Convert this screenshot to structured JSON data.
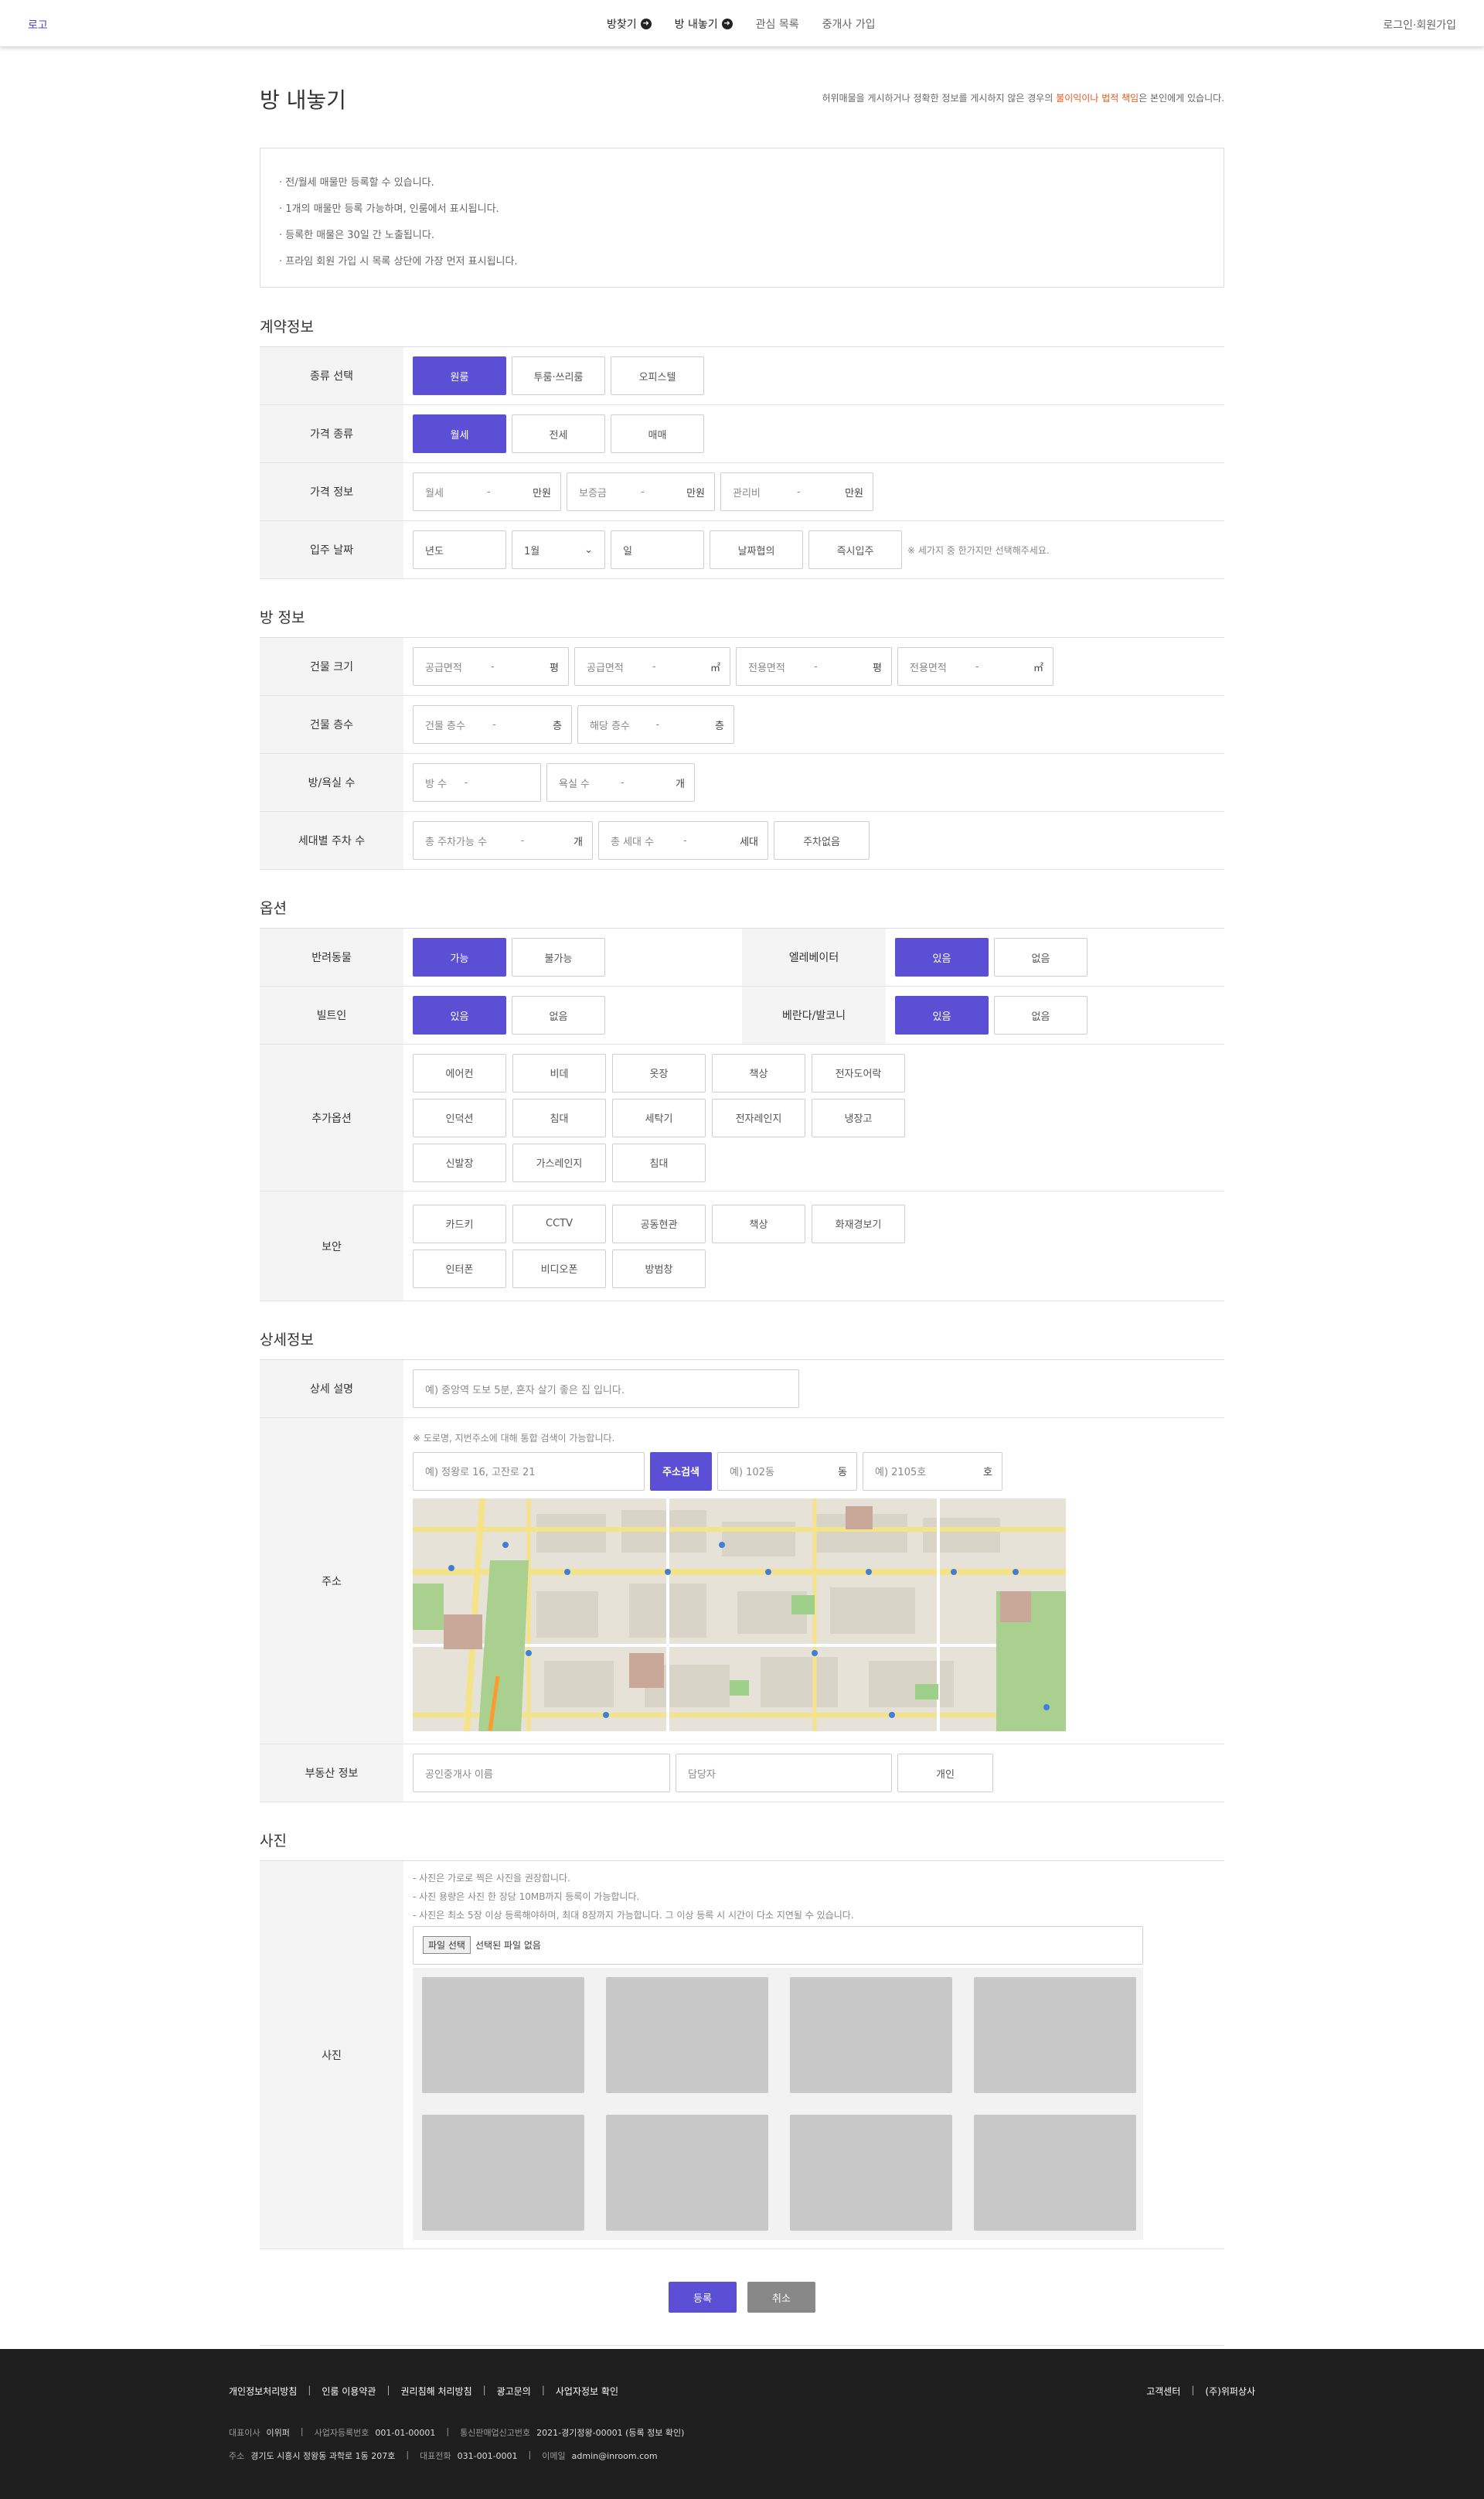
{
  "header": {
    "logo": "로고",
    "menu": [
      {
        "label": "방찾기",
        "icon": "arrow-circle-icon"
      },
      {
        "label": "방 내놓기",
        "icon": "arrow-circle-icon"
      },
      {
        "label": "관심 목록"
      },
      {
        "label": "중개사 가입"
      }
    ],
    "login": "로그인·회원가입"
  },
  "page": {
    "title": "방 내놓기",
    "warning_pre": "허위매물을 게시하거나 정확한 정보를 게시하지 않은 경우의 ",
    "warning_em": "불이익이나 법적 책임",
    "warning_post": "은 본인에게 있습니다."
  },
  "notice": [
    "· 전/월세 매물만 등록할 수 있습니다.",
    "· 1개의 매물만 등록 가능하며, 인룸에서 표시됩니다.",
    "· 등록한 매물은 30일 간 노출됩니다.",
    "· 프라임 회원 가입 시 목록 상단에 가장 먼저 표시됩니다."
  ],
  "contract": {
    "title": "계약정보",
    "type_label": "종류 선택",
    "types": [
      "원룸",
      "투룸·쓰리룸",
      "오피스텔"
    ],
    "price_type_label": "가격 종류",
    "price_types": [
      "월세",
      "전세",
      "매매"
    ],
    "price_info_label": "가격 정보",
    "price_inputs": [
      {
        "placeholder": "월세",
        "unit": "만원"
      },
      {
        "placeholder": "보증금",
        "unit": "만원"
      },
      {
        "placeholder": "관리비",
        "unit": "만원"
      }
    ],
    "move_in_label": "입주 날짜",
    "year": "년도",
    "month": "1월",
    "day": "일",
    "negotiable": "날짜협의",
    "immediate": "즉시입주",
    "move_in_hint": "※ 세가지 중 한가지만 선택해주세요."
  },
  "room": {
    "title": "방 정보",
    "size_label": "건물 크기",
    "size_inputs": [
      {
        "placeholder": "공급면적",
        "unit": "평"
      },
      {
        "placeholder": "공급면적",
        "unit": "㎡"
      },
      {
        "placeholder": "전용면적",
        "unit": "평"
      },
      {
        "placeholder": "전용면적",
        "unit": "㎡"
      }
    ],
    "floors_label": "건물 층수",
    "floor_inputs": [
      {
        "placeholder": "건물 층수",
        "unit": "층"
      },
      {
        "placeholder": "해당 층수",
        "unit": "층"
      }
    ],
    "rooms_label": "방/욕실 수",
    "room_inputs": [
      {
        "placeholder": "방 수",
        "unit": ""
      },
      {
        "placeholder": "욕실 수",
        "unit": "개"
      }
    ],
    "parking_label": "세대별 주차 수",
    "parking_inputs": [
      {
        "placeholder": "총 주차가능 수",
        "unit": "개"
      },
      {
        "placeholder": "총 세대 수",
        "unit": "세대"
      }
    ],
    "no_parking": "주차없음"
  },
  "options": {
    "title": "옵션",
    "pet_label": "반려동물",
    "pet": [
      "가능",
      "불가능"
    ],
    "elevator_label": "엘레베이터",
    "elevator": [
      "있음",
      "없음"
    ],
    "builtin_label": "빌트인",
    "builtin": [
      "있음",
      "없음"
    ],
    "balcony_label": "베란다/발코니",
    "balcony": [
      "있음",
      "없음"
    ],
    "extra_label": "추가옵션",
    "extra": [
      "에어컨",
      "비데",
      "옷장",
      "책상",
      "전자도어락",
      "인덕션",
      "침대",
      "세탁기",
      "전자레인지",
      "냉장고",
      "신발장",
      "가스레인지",
      "침대"
    ],
    "security_label": "보안",
    "security": [
      "카드키",
      "CCTV",
      "공동현관",
      "책상",
      "화재경보기",
      "인터폰",
      "비디오폰",
      "방범창"
    ]
  },
  "detail": {
    "title": "상세정보",
    "desc_label": "상세 설명",
    "desc_placeholder": "예) 중앙역 도보 5분, 혼자 살기 좋은 집 입니다.",
    "address_label": "주소",
    "address_hint": "※ 도로명, 지번주소에 대해 통합 검색이 가능합니다.",
    "address_placeholder": "예) 정왕로 16, 고잔로 21",
    "search_btn": "주소검색",
    "dong_placeholder": "예) 102동",
    "dong_unit": "동",
    "ho_placeholder": "예) 2105호",
    "ho_unit": "호",
    "agent_label": "부동산 정보",
    "agent_placeholder": "공인중개사 이름",
    "manager_placeholder": "담당자",
    "personal": "개인"
  },
  "photo": {
    "title": "사진",
    "label": "사진",
    "hints": [
      "- 사진은 가로로 찍은 사진을 권장합니다.",
      "- 사진 용량은 사진 한 장당 10MB까지 등록이 가능합니다.",
      "- 사진은 최소 5장 이상 등록해야하며, 최대 8장까지 가능합니다. 그 이상 등록 시 시간이 다소 지연될 수 있습니다."
    ],
    "file_btn": "파일 선택",
    "file_status": "선택된 파일 없음"
  },
  "actions": {
    "submit": "등록",
    "cancel": "취소"
  },
  "footer": {
    "links": [
      "개인정보처리방침",
      "인룸 이용약관",
      "권리침해 처리방침",
      "광고문의",
      "사업자정보 확인"
    ],
    "right": [
      "고객센터",
      "(주)위퍼상사"
    ],
    "ceo_label": "대표이사",
    "ceo": "이위퍼",
    "biz_label": "사업자등록번호",
    "biz": "001-01-00001",
    "sales_label": "통신판매업신고번호",
    "sales": "2021-경기정왕-00001 (등록 정보 확인)",
    "addr_label": "주소",
    "addr": "경기도 시흥시 정왕동 과학로 1동 207호",
    "tel_label": "대표전화",
    "tel": "031-001-0001",
    "email_label": "이메일",
    "email": "admin@inroom.com"
  },
  "colors": {
    "accent": "#5b4fd6",
    "warning": "#e35b1f",
    "footer_bg": "#1e1e1e"
  }
}
